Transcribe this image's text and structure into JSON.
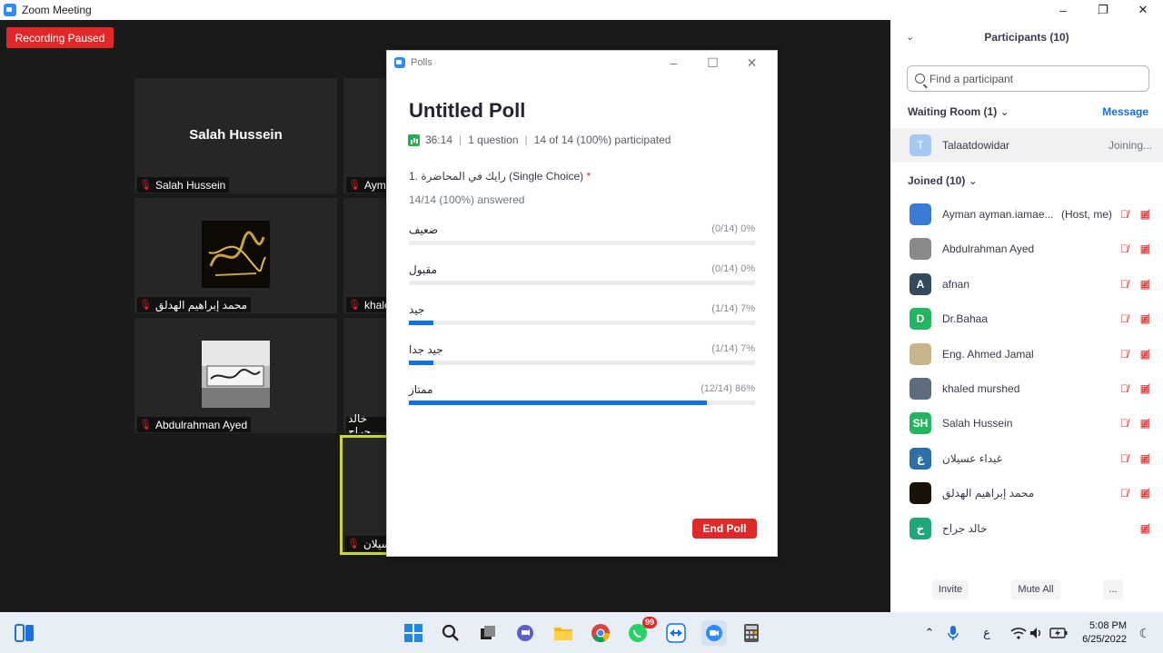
{
  "window": {
    "title": "Zoom Meeting"
  },
  "meeting": {
    "recording_badge": "Recording Paused",
    "tiles": [
      {
        "big_name": "Salah Hussein",
        "label": "Salah Hussein"
      },
      {
        "label": "Ayma"
      },
      {
        "label": "محمد إبراهيم الهدلق"
      },
      {
        "label": "khale"
      },
      {
        "label": "Abdulrahman Ayed"
      },
      {
        "label": "خالد جراح"
      },
      {
        "label": "سيلان"
      }
    ]
  },
  "polls": {
    "window_title": "Polls",
    "title": "Untitled Poll",
    "duration": "36:14",
    "questions_count": "1 question",
    "participation": "14 of 14 (100%) participated",
    "question": "1. رايك في المحاضرة (Single Choice)",
    "required_mark": "*",
    "answered": "14/14 (100%) answered",
    "options": [
      {
        "label": "ضعيف",
        "stat": "(0/14) 0%",
        "percent": 0
      },
      {
        "label": "مقبول",
        "stat": "(0/14) 0%",
        "percent": 0
      },
      {
        "label": "جيد",
        "stat": "(1/14) 7%",
        "percent": 7
      },
      {
        "label": "جيد جدا",
        "stat": "(1/14) 7%",
        "percent": 7
      },
      {
        "label": "ممتاز",
        "stat": "(12/14) 86%",
        "percent": 86
      }
    ],
    "end_button": "End Poll"
  },
  "participants": {
    "header": "Participants (10)",
    "search_placeholder": "Find a participant",
    "waiting_room": {
      "header": "Waiting Room (1)",
      "message_label": "Message",
      "name": "Talaatdowidar",
      "initial": "T",
      "status": "Joining..."
    },
    "joined_header": "Joined (10)",
    "joined": [
      {
        "name": "Ayman ayman.iamae...",
        "role": "(Host, me)",
        "initial": "",
        "color": "#3a7bd5",
        "mic": true
      },
      {
        "name": "Abdulrahman Ayed",
        "role": "",
        "initial": "",
        "color": "#8a8a8a",
        "mic": true
      },
      {
        "name": "afnan",
        "role": "",
        "initial": "A",
        "color": "#34495e",
        "mic": true
      },
      {
        "name": "Dr.Bahaa",
        "role": "",
        "initial": "D",
        "color": "#23b55f",
        "mic": true
      },
      {
        "name": "Eng. Ahmed Jamal",
        "role": "",
        "initial": "",
        "color": "#c8b48a",
        "mic": true
      },
      {
        "name": "khaled murshed",
        "role": "",
        "initial": "",
        "color": "#5d6d7e",
        "mic": true
      },
      {
        "name": "Salah Hussein",
        "role": "",
        "initial": "SH",
        "color": "#23b55f",
        "mic": true
      },
      {
        "name": "غيداء عسيلان",
        "role": "",
        "initial": "غ",
        "color": "#2d6fa8",
        "mic": true
      },
      {
        "name": "محمد إبراهيم الهدلق",
        "role": "",
        "initial": "",
        "color": "#1a1206",
        "mic": true
      },
      {
        "name": "خالد جراح",
        "role": "",
        "initial": "خ",
        "color": "#1fa67a",
        "mic": false
      }
    ],
    "invite_label": "Invite",
    "mute_all_label": "Mute All",
    "more_label": "..."
  },
  "taskbar": {
    "whatsapp_badge": "99",
    "input_lang": "ع",
    "time": "5:08 PM",
    "date": "6/25/2022"
  }
}
